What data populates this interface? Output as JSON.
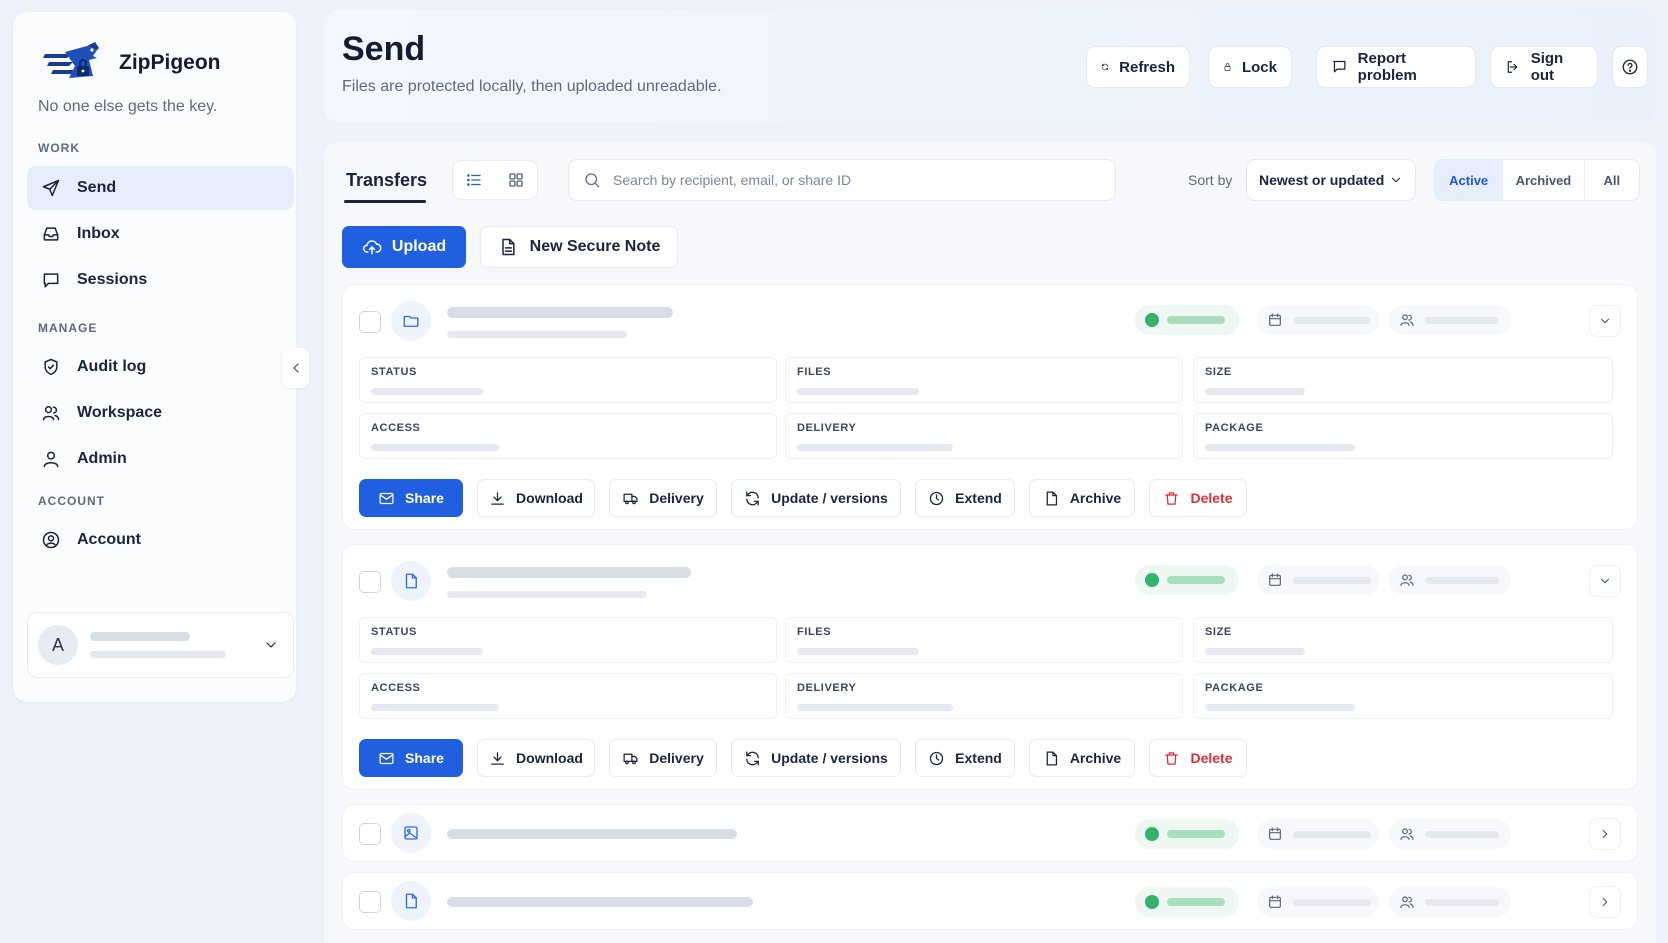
{
  "brand": {
    "name": "ZipPigeon",
    "tagline": "No one else gets the key."
  },
  "sidebar": {
    "sections": [
      {
        "label": "WORK",
        "items": [
          {
            "label": "Send",
            "icon": "send-icon",
            "active": true
          },
          {
            "label": "Inbox",
            "icon": "inbox-icon"
          },
          {
            "label": "Sessions",
            "icon": "chat-icon"
          }
        ]
      },
      {
        "label": "MANAGE",
        "items": [
          {
            "label": "Audit log",
            "icon": "shield-check-icon"
          },
          {
            "label": "Workspace",
            "icon": "users-icon"
          },
          {
            "label": "Admin",
            "icon": "user-icon"
          }
        ]
      },
      {
        "label": "ACCOUNT",
        "items": [
          {
            "label": "Account",
            "icon": "user-circle-icon"
          }
        ]
      }
    ],
    "user": {
      "initial": "A"
    }
  },
  "header": {
    "title": "Send",
    "subtitle": "Files are protected locally, then uploaded unreadable.",
    "buttons": {
      "refresh": "Refresh",
      "lock": "Lock",
      "report": "Report problem",
      "signout": "Sign out"
    }
  },
  "toolbar": {
    "tab": "Transfers",
    "search_placeholder": "Search by recipient, email, or share ID",
    "sort_label": "Sort by",
    "sort_value": "Newest or updated",
    "filters": [
      "Active",
      "Archived",
      "All"
    ],
    "active_filter": "Active",
    "upload_label": "Upload",
    "note_label": "New Secure Note"
  },
  "card_fields": {
    "status": "STATUS",
    "files": "FILES",
    "size": "SIZE",
    "access": "ACCESS",
    "delivery": "DELIVERY",
    "package": "PACKAGE"
  },
  "card_actions": {
    "share": "Share",
    "download": "Download",
    "delivery": "Delivery",
    "update": "Update / versions",
    "extend": "Extend",
    "archive": "Archive",
    "delete": "Delete"
  },
  "transfers": [
    {
      "type": "folder-icon",
      "expanded": true
    },
    {
      "type": "document-icon",
      "expanded": true
    },
    {
      "type": "image-icon",
      "expanded": false
    },
    {
      "type": "document-icon",
      "expanded": false
    }
  ],
  "colors": {
    "accent": "#1f5fe0",
    "danger": "#dc2f3a",
    "success": "#34b36a",
    "active_bg": "#e6eefb"
  }
}
